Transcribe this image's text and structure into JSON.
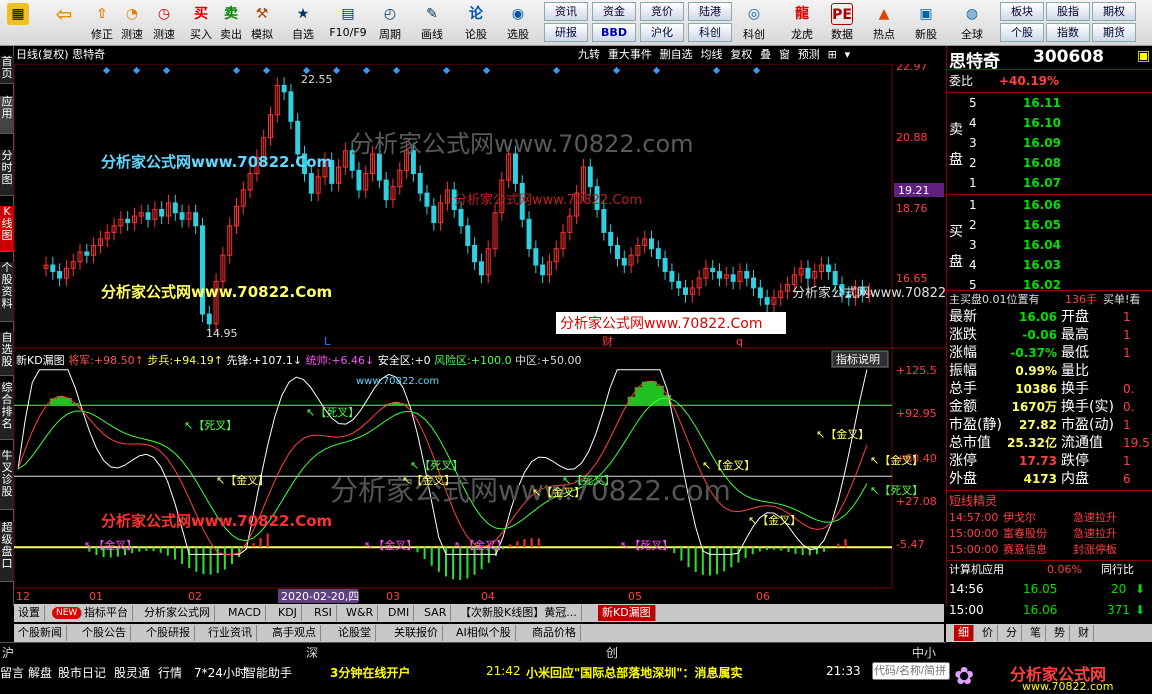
{
  "toolbar": {
    "left": [
      {
        "label": "",
        "icon": "app-grid"
      },
      {
        "label": "",
        "icon": "back-arrow"
      },
      {
        "label": "修正",
        "icon": "pin"
      },
      {
        "label": "测速",
        "icon": "speed"
      },
      {
        "label": "买入",
        "icon": "buy"
      },
      {
        "label": "卖出",
        "icon": "sell"
      },
      {
        "label": "模拟",
        "icon": "hammer"
      },
      {
        "label": "自选",
        "icon": "star"
      },
      {
        "label": "F10/F9",
        "icon": "f10"
      },
      {
        "label": "周期",
        "icon": "clock"
      },
      {
        "label": "画线",
        "icon": "pen"
      },
      {
        "label": "论股",
        "icon": "discuss"
      },
      {
        "label": "选股",
        "icon": "filter"
      }
    ],
    "grid": [
      [
        "资讯",
        "资金",
        "竞价",
        "陆港"
      ],
      [
        "研报",
        "BBD",
        "沪化",
        "科创"
      ]
    ],
    "right": [
      {
        "label": "龙虎",
        "icon": "dragon"
      },
      {
        "label": "数据",
        "icon": "data"
      },
      {
        "label": "热点",
        "icon": "hot"
      },
      {
        "label": "新股",
        "icon": "ipo"
      },
      {
        "label": "全球",
        "icon": "globe"
      }
    ],
    "grid2": [
      [
        "板块",
        "股指",
        "期权"
      ],
      [
        "个股",
        "指数",
        "期货"
      ]
    ]
  },
  "chart_title": "日线(复权)  思特奇",
  "chart_buttons": [
    "九转",
    "重大事件",
    "删自选",
    "均线",
    "复权",
    "叠",
    "窗",
    "预测"
  ],
  "left_tabs": [
    "首页",
    "应用",
    "分时图",
    "K线图",
    "个股资料",
    "自选股",
    "综合排名",
    "牛叉诊股",
    "超级盘口"
  ],
  "price_axis": [
    "22.97",
    "20.88",
    "18.76",
    "16.65",
    "14.95"
  ],
  "current_price_tag": "19.21",
  "annotations": {
    "high": "22.55",
    "low": "14.95",
    "l1": "L",
    "l2": "L",
    "cai": "财",
    "q": "q"
  },
  "x_axis": [
    "12",
    "01",
    "02",
    "03",
    "04",
    "05",
    "06"
  ],
  "date_cursor": "2020-02-20,四",
  "watermarks": [
    "分析家公式网www.70822.Com",
    "分析家公式网www.70822.Com",
    "分析家公式网www.70822.Com",
    "分析家公式网www.70822.Com",
    "分析家公式网www.70822.com",
    "分析家公式网www.70822.Com",
    "分析家公式网www.70822.Com",
    "分析家公式网www.70822.com",
    "www.70822.com"
  ],
  "indicator": {
    "name": "新KD漏图",
    "items": [
      {
        "label": "将军:",
        "value": "+98.50↑",
        "color": "#ff5050"
      },
      {
        "label": "步兵:",
        "value": "+94.19↑",
        "color": "#ffff60"
      },
      {
        "label": "先锋:",
        "value": "+107.1↓",
        "color": "#ffffff"
      },
      {
        "label": "统帅:",
        "value": "+6.46↓",
        "color": "#ff50ff"
      },
      {
        "label": "安全区:",
        "value": "+0",
        "color": "#ffffff"
      },
      {
        "label": "风险区:",
        "value": "+100.0",
        "color": "#50ff50"
      },
      {
        "label": "中区:",
        "value": "+50.00",
        "color": "#dddddd"
      }
    ],
    "button": "指标说明",
    "axis": [
      "+125.5",
      "+92.95",
      "+60.40",
      "+27.08",
      "-5.47"
    ],
    "labels": [
      "【死叉】",
      "【死叉】",
      "【金叉】",
      "【死叉】",
      "【金叉】",
      "【金叉】",
      "【死叉】",
      "【金叉】",
      "【金叉】",
      "【金叉】",
      "【金叉】",
      "【金叉】",
      "【死叉】",
      "【金叉】",
      "【死叉】",
      "【金叉】"
    ]
  },
  "stock": {
    "name": "思特奇",
    "code": "300608",
    "ratio_label": "委比",
    "ratio": "+40.19%",
    "sell": [
      [
        "5",
        "16.11"
      ],
      [
        "4",
        "16.10"
      ],
      [
        "3",
        "16.09"
      ],
      [
        "2",
        "16.08"
      ],
      [
        "1",
        "16.07"
      ]
    ],
    "sell_label": [
      "卖",
      "盘"
    ],
    "buy": [
      [
        "1",
        "16.06"
      ],
      [
        "2",
        "16.05"
      ],
      [
        "3",
        "16.04"
      ],
      [
        "4",
        "16.03"
      ],
      [
        "5",
        "16.02"
      ]
    ],
    "buy_label": [
      "买",
      "盘"
    ],
    "level": "主买盘0.01位置有",
    "level_num": "136手",
    "level_r": "买单!看",
    "stats": [
      [
        "最新",
        "16.06",
        "开盘",
        "1"
      ],
      [
        "涨跌",
        "-0.06",
        "最高",
        "1"
      ],
      [
        "涨幅",
        "-0.37%",
        "最低",
        "1"
      ],
      [
        "振幅",
        "0.99%",
        "量比",
        ""
      ],
      [
        "总手",
        "10386",
        "换手",
        "0."
      ],
      [
        "金额",
        "1670万",
        "换手(实)",
        "0."
      ],
      [
        "市盈(静)",
        "27.82",
        "市盈(动)",
        "1"
      ],
      [
        "总市值",
        "25.32亿",
        "流通值",
        "19.5"
      ],
      [
        "涨停",
        "17.73",
        "跌停",
        "1"
      ],
      [
        "外盘",
        "4173",
        "内盘",
        "6"
      ]
    ]
  },
  "elves": {
    "title": "短线精灵",
    "rows": [
      [
        "14:57:00",
        "伊戈尔",
        "急速拉升"
      ],
      [
        "15:00:00",
        "富春股份",
        "急速拉升"
      ],
      [
        "15:00:00",
        "赛意信息",
        "封涨停板"
      ]
    ]
  },
  "calc": {
    "label": "计算机应用",
    "value": "0.06%",
    "right": "同行比"
  },
  "ticks": [
    [
      "14:56",
      "16.05",
      "20"
    ],
    [
      "15:00",
      "16.06",
      "371"
    ]
  ],
  "tabs": [
    "设置",
    "NEW",
    "指标平台",
    "分析家公式网",
    "MACD",
    "KDJ",
    "RSI",
    "W&R",
    "DMI",
    "SAR",
    "【次新股K线图】黄冠...",
    "新KD漏图"
  ],
  "tabs2": [
    "个股新闻",
    "个股公告",
    "个股研报",
    "行业资讯",
    "高手观点",
    "论股堂",
    "关联报价",
    "AI相似个股",
    "商品价格"
  ],
  "markets": [
    "沪",
    "深",
    "创",
    "中小板"
  ],
  "status": [
    "留言",
    "解盘",
    "股市日记",
    "股灵通",
    "行情",
    "7*24小时",
    "智能助手"
  ],
  "ticker": "3分钟在线开户",
  "news_time": "21:42",
  "news": "小米回应\"国际总部落地深圳\"：消息属实",
  "clock": "21:33",
  "search_placeholder": "代码/名称/简拼",
  "logo": "分析家公式网",
  "logo_url": "www.70822.com",
  "right_tabs": [
    "细",
    "价",
    "分",
    "笔",
    "势",
    "财"
  ]
}
